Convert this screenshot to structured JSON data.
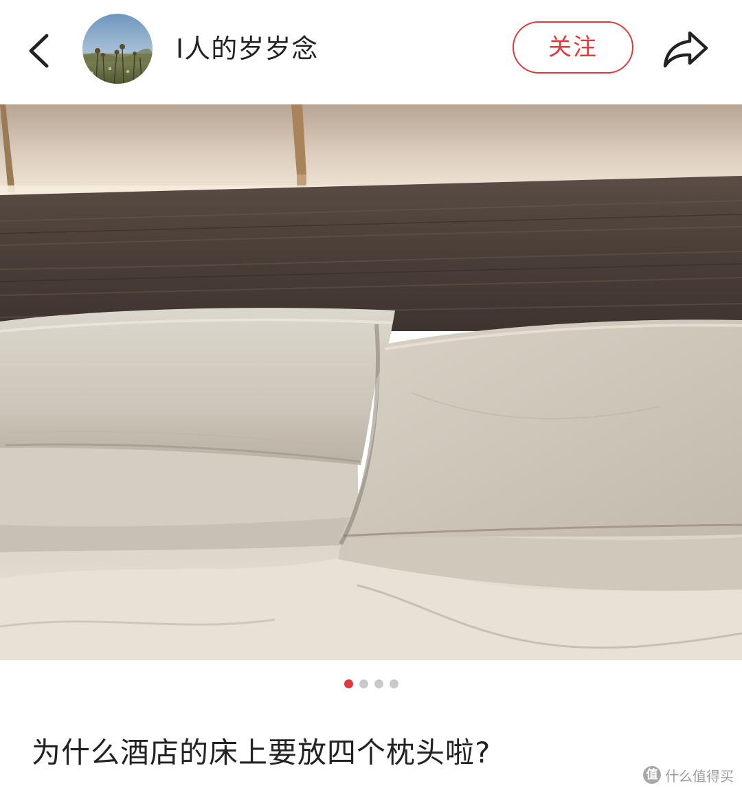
{
  "header": {
    "author_name": "I人的岁岁念",
    "follow_label": "关注",
    "back_icon": "chevron-left-icon",
    "share_icon": "share-arrow-icon"
  },
  "hero": {
    "image_description": "",
    "pagination": {
      "total": 4,
      "current": 1
    }
  },
  "post": {
    "title": "为什么酒店的床上要放四个枕头啦?"
  },
  "watermark": {
    "logo_glyph": "值",
    "text": "什么值得买"
  },
  "colors": {
    "accent": "#e4393c",
    "text": "#222222",
    "dot_inactive": "#c9c9c9"
  }
}
